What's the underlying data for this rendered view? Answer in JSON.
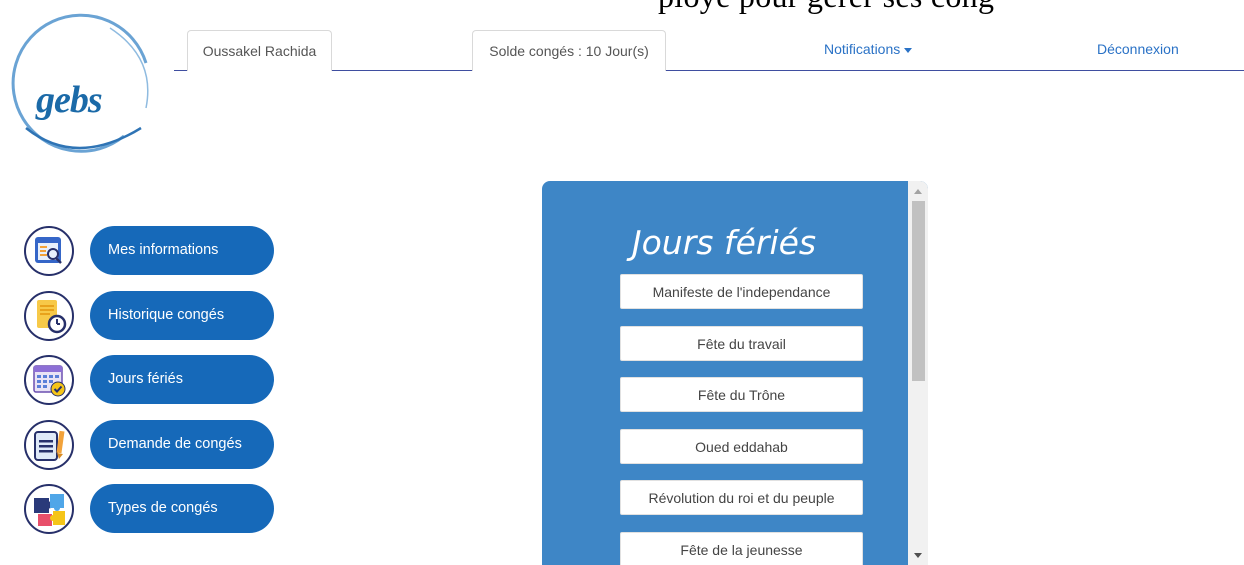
{
  "top_text_fragment": "ployé   pour gérer ses cong",
  "logo": {
    "text": "gebs"
  },
  "nav": {
    "user_name": "Oussakel Rachida",
    "solde": "Solde congés : 10 Jour(s)",
    "notifications": "Notifications",
    "logout": "Déconnexion"
  },
  "sidebar": {
    "items": [
      {
        "label": "Mes informations",
        "icon": "profile-search-icon"
      },
      {
        "label": "Historique congés",
        "icon": "document-clock-icon"
      },
      {
        "label": "Jours fériés",
        "icon": "calendar-check-icon"
      },
      {
        "label": "Demande de congés",
        "icon": "document-list-icon"
      },
      {
        "label": "Types de congés",
        "icon": "puzzle-icon"
      }
    ]
  },
  "panel": {
    "title": "Jours fériés",
    "holidays": [
      "Manifeste de l'independance",
      "Fête du travail",
      "Fête du Trône",
      "Oued eddahab",
      "Révolution du roi et du peuple",
      "Fête de la jeunesse"
    ]
  },
  "colors": {
    "accent": "#1669b9",
    "panel": "#3e86c6",
    "nav_line": "#3f4ea0",
    "link": "#2a72c6"
  }
}
